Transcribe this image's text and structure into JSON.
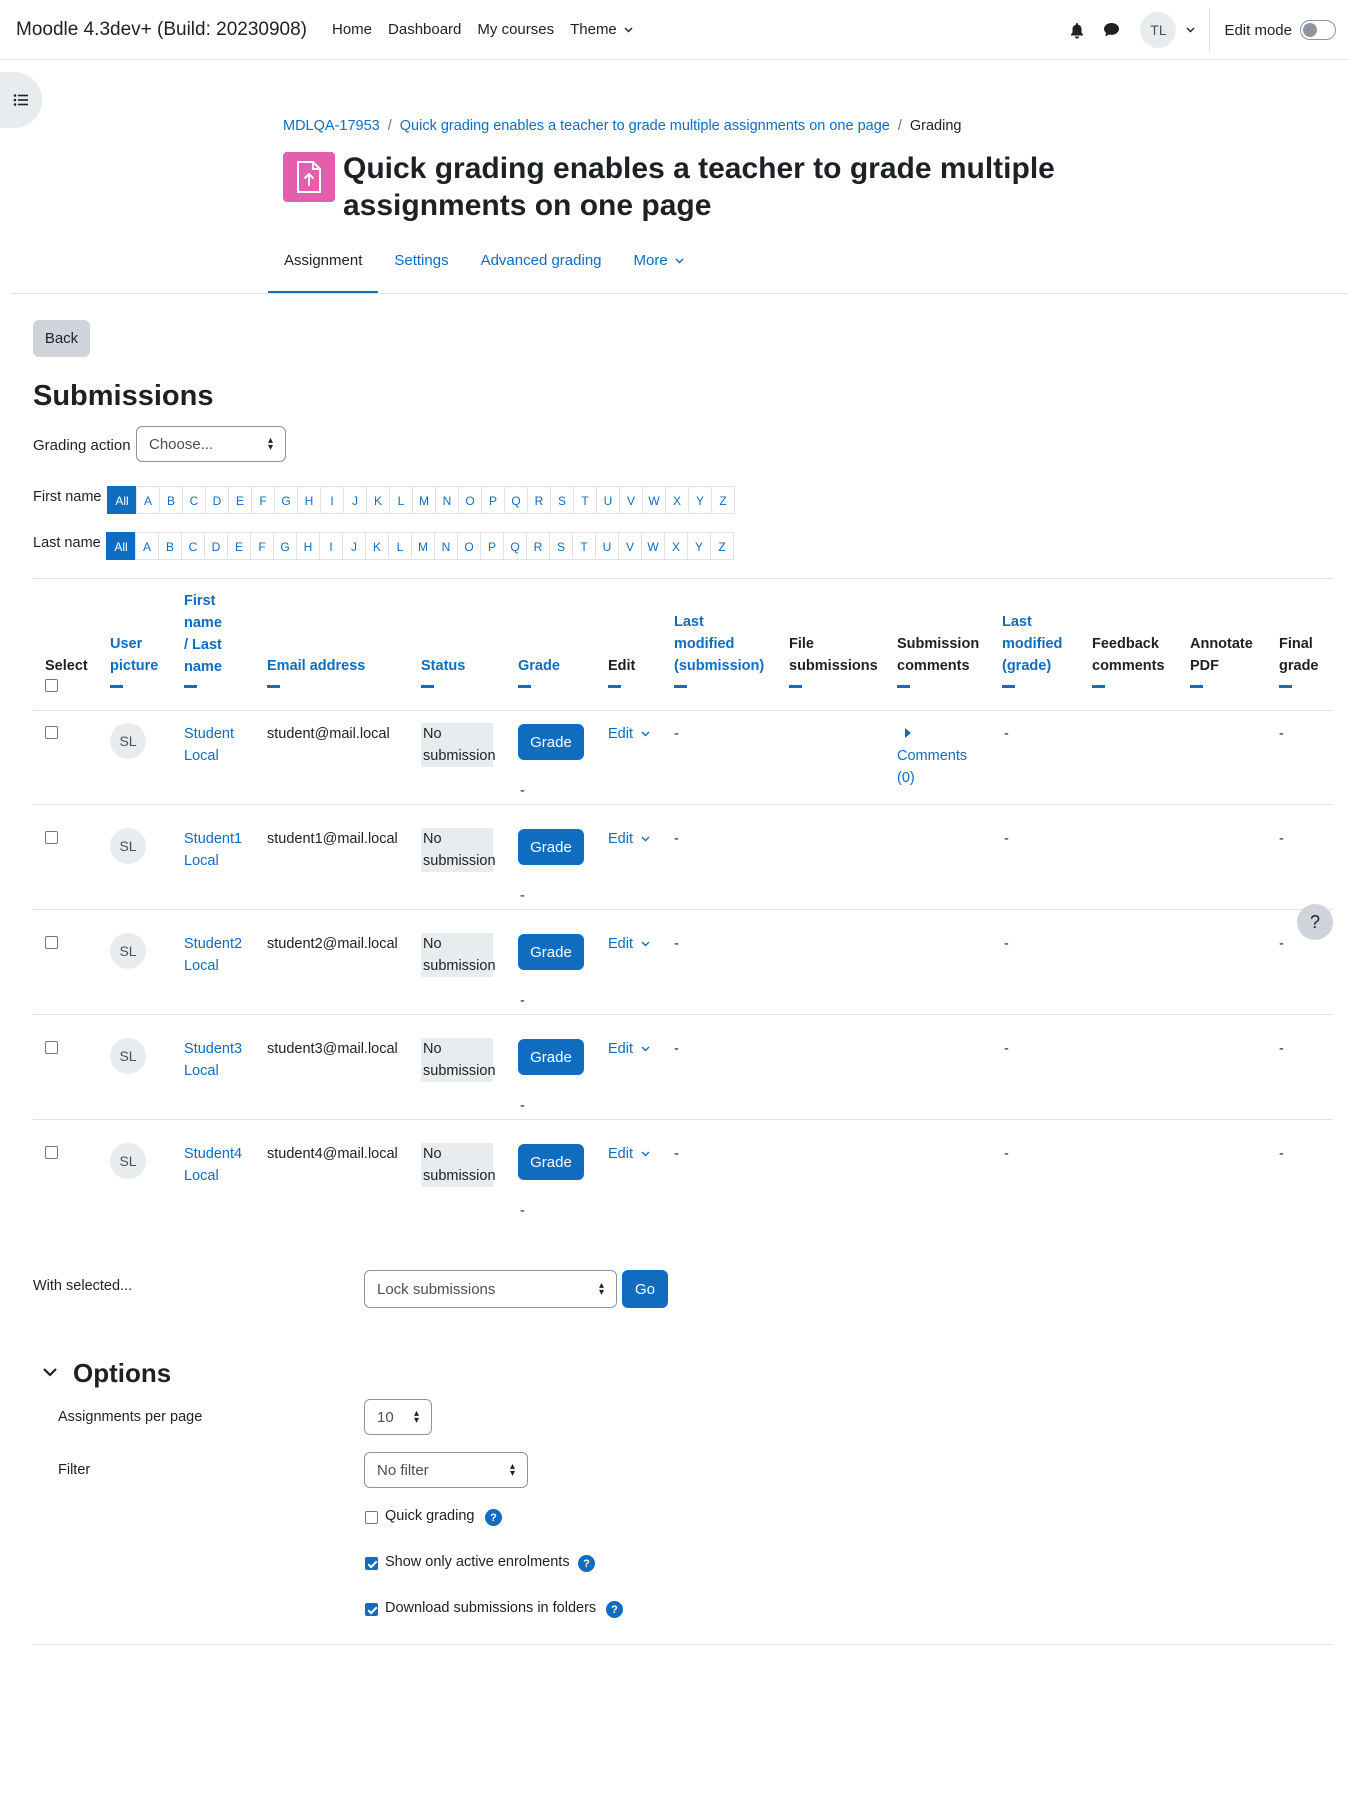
{
  "navbar": {
    "brand": "Moodle 4.3dev+ (Build: 20230908)",
    "links": [
      "Home",
      "Dashboard",
      "My courses",
      "Theme"
    ],
    "user_initials": "TL",
    "edit_mode_label": "Edit mode"
  },
  "breadcrumb": {
    "items": [
      "MDLQA-17953",
      "Quick grading enables a teacher to grade multiple assignments on one page",
      "Grading"
    ],
    "separator": "/"
  },
  "page_title": "Quick grading enables a teacher to grade multiple assignments on one page",
  "secondary_nav": {
    "tabs": [
      "Assignment",
      "Settings",
      "Advanced grading",
      "More"
    ],
    "active": "Assignment"
  },
  "back_label": "Back",
  "submissions_heading": "Submissions",
  "grading_action": {
    "label": "Grading action",
    "value": "Choose..."
  },
  "first_name_label": "First name",
  "last_name_label": "Last name",
  "letters": [
    "All",
    "A",
    "B",
    "C",
    "D",
    "E",
    "F",
    "G",
    "H",
    "I",
    "J",
    "K",
    "L",
    "M",
    "N",
    "O",
    "P",
    "Q",
    "R",
    "S",
    "T",
    "U",
    "V",
    "W",
    "X",
    "Y",
    "Z"
  ],
  "table": {
    "headers": {
      "select": "Select",
      "user_picture": [
        "User",
        "picture"
      ],
      "name": [
        "First",
        "name",
        "/ Last",
        "name"
      ],
      "email": "Email address",
      "status": "Status",
      "grade": "Grade",
      "edit": "Edit",
      "last_modified_submission": [
        "Last",
        "modified",
        "(submission)"
      ],
      "file_submissions": [
        "File",
        "submissions"
      ],
      "submission_comments": [
        "Submission",
        "comments"
      ],
      "last_modified_grade": [
        "Last",
        "modified",
        "(grade)"
      ],
      "feedback_comments": [
        "Feedback",
        "comments"
      ],
      "annotate_pdf": [
        "Annotate",
        "PDF"
      ],
      "final_grade": [
        "Final",
        "grade"
      ]
    },
    "rows": [
      {
        "initials": "SL",
        "first": "Student",
        "last": "Local",
        "email": "student@mail.local",
        "status1": "No",
        "status2": "submission",
        "grade_btn": "Grade",
        "grade_below": "-",
        "edit": "Edit",
        "lm_sub": "-",
        "comments1": "Comments",
        "comments2": "(0)",
        "lm_grade": "-",
        "final": "-"
      },
      {
        "initials": "SL",
        "first": "Student1",
        "last": "Local",
        "email": "student1@mail.local",
        "status1": "No",
        "status2": "submission",
        "grade_btn": "Grade",
        "grade_below": "-",
        "edit": "Edit",
        "lm_sub": "-",
        "lm_grade": "-",
        "final": "-"
      },
      {
        "initials": "SL",
        "first": "Student2",
        "last": "Local",
        "email": "student2@mail.local",
        "status1": "No",
        "status2": "submission",
        "grade_btn": "Grade",
        "grade_below": "-",
        "edit": "Edit",
        "lm_sub": "-",
        "lm_grade": "-",
        "final": "-"
      },
      {
        "initials": "SL",
        "first": "Student3",
        "last": "Local",
        "email": "student3@mail.local",
        "status1": "No",
        "status2": "submission",
        "grade_btn": "Grade",
        "grade_below": "-",
        "edit": "Edit",
        "lm_sub": "-",
        "lm_grade": "-",
        "final": "-"
      },
      {
        "initials": "SL",
        "first": "Student4",
        "last": "Local",
        "email": "student4@mail.local",
        "status1": "No",
        "status2": "submission",
        "grade_btn": "Grade",
        "grade_below": "-",
        "edit": "Edit",
        "lm_sub": "-",
        "lm_grade": "-",
        "final": "-"
      }
    ]
  },
  "with_selected": {
    "label": "With selected...",
    "value": "Lock submissions",
    "go": "Go"
  },
  "options": {
    "heading": "Options",
    "per_page_label": "Assignments per page",
    "per_page_value": "10",
    "filter_label": "Filter",
    "filter_value": "No filter",
    "quick_grading": "Quick grading",
    "show_active": "Show only active enrolments",
    "download_folders": "Download submissions in folders"
  },
  "help_float": "?",
  "help_dot": "?",
  "colors": {
    "accent": "#0f6cbf",
    "module_icon": "#e45eae"
  }
}
